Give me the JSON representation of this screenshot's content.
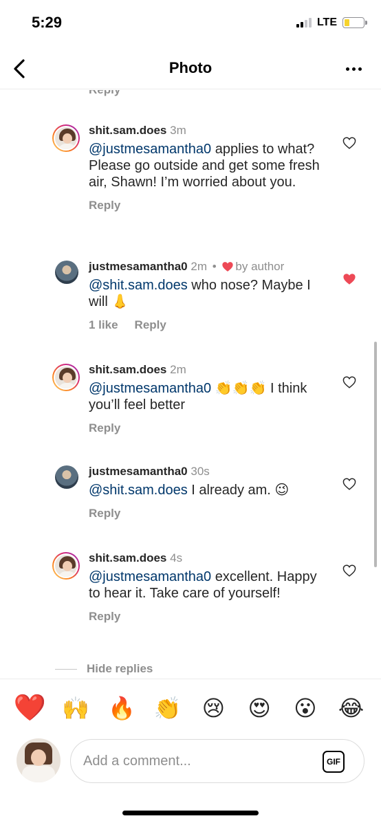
{
  "status_bar": {
    "time": "5:29",
    "network": "LTE",
    "signal_bars_active": 2,
    "signal_bars_total": 4,
    "battery_level": 0.25,
    "battery_color": "#f6d32d"
  },
  "nav": {
    "title": "Photo",
    "back_icon": "chevron-left-icon",
    "more_icon": "more-horizontal-icon"
  },
  "thread": {
    "partial_reply_label": "Reply",
    "comments": [
      {
        "username": "shit.sam.does",
        "time": "3m",
        "mention": "@justmesamantha0",
        "text": " applies to what? Please go outside and get some fresh air, Shawn! I’m worried about you.",
        "reply_label": "Reply",
        "liked": false
      },
      {
        "username": "justmesamantha0",
        "time": "2m",
        "dot": "•",
        "by_author": "by author",
        "mention": "@shit.sam.does",
        "text": " who nose? Maybe I will 👃",
        "likes": "1 like",
        "reply_label": "Reply",
        "liked": true
      },
      {
        "username": "shit.sam.does",
        "time": "2m",
        "mention": "@justmesamantha0",
        "text": " 👏👏👏 I think you’ll feel better",
        "reply_label": "Reply",
        "liked": false
      },
      {
        "username": "justmesamantha0",
        "time": "30s",
        "mention": "@shit.sam.does",
        "text": " I already am. 😉",
        "reply_label": "Reply",
        "liked": false
      },
      {
        "username": "shit.sam.does",
        "time": "4s",
        "mention": "@justmesamantha0",
        "text": " excellent. Happy to hear it. Take care of yourself!",
        "reply_label": "Reply",
        "liked": false
      }
    ],
    "hide_replies_label": "Hide replies"
  },
  "composer": {
    "quick_emojis": [
      "❤️",
      "🙌",
      "🔥",
      "👏",
      "😢",
      "😍",
      "😮",
      "😂"
    ],
    "placeholder": "Add a comment...",
    "gif_label": "GIF"
  },
  "colors": {
    "mention": "#00376b",
    "liked_heart": "#ed4956",
    "muted_text": "#8e8e8e"
  }
}
